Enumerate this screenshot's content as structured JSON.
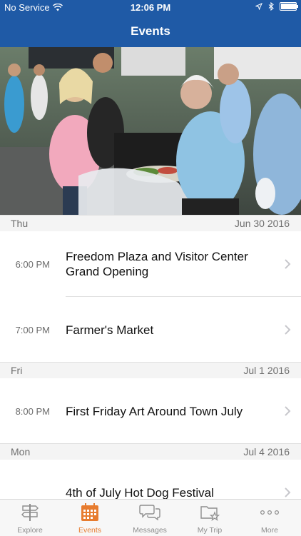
{
  "status": {
    "carrier": "No Service",
    "time": "12:06 PM",
    "battery_level": 0.95
  },
  "header": {
    "title": "Events"
  },
  "hero": {
    "icon": "event-photo"
  },
  "sections": [
    {
      "day": "Thu",
      "date": "Jun 30 2016",
      "events": [
        {
          "time": "6:00 PM",
          "title": "Freedom Plaza and Visitor Center Grand Opening"
        },
        {
          "time": "7:00 PM",
          "title": "Farmer's Market"
        }
      ]
    },
    {
      "day": "Fri",
      "date": "Jul 1 2016",
      "events": [
        {
          "time": "8:00 PM",
          "title": "First Friday Art Around Town July"
        }
      ]
    },
    {
      "day": "Mon",
      "date": "Jul 4 2016",
      "events": [
        {
          "time": "",
          "title": "4th of July Hot Dog Festival"
        }
      ]
    }
  ],
  "tabs": [
    {
      "label": "Explore",
      "icon": "signpost-icon"
    },
    {
      "label": "Events",
      "icon": "calendar-icon",
      "active": true
    },
    {
      "label": "Messages",
      "icon": "chat-bubbles-icon"
    },
    {
      "label": "My Trip",
      "icon": "folder-star-icon"
    },
    {
      "label": "More",
      "icon": "more-dots-icon"
    }
  ],
  "colors": {
    "brand_blue": "#1f5aa6",
    "active_tab": "#e77c2f",
    "inactive_tab": "#8e8e8e"
  }
}
